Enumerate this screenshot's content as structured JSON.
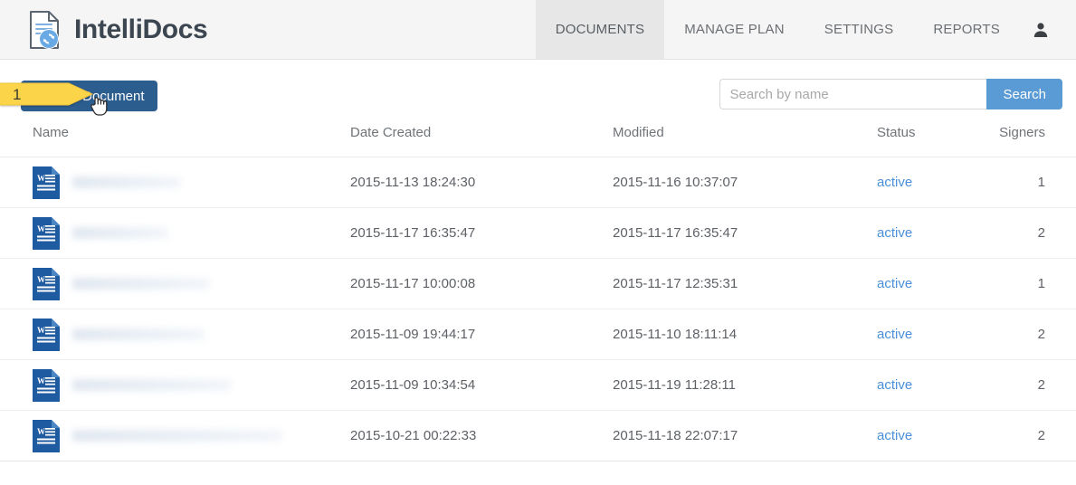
{
  "brand": {
    "name": "IntelliDocs",
    "logo_icon": "document-sync-icon"
  },
  "nav": {
    "items": [
      {
        "label": "DOCUMENTS",
        "active": true
      },
      {
        "label": "MANAGE PLAN",
        "active": false
      },
      {
        "label": "SETTINGS",
        "active": false
      },
      {
        "label": "REPORTS",
        "active": false
      }
    ],
    "user_icon": "user-avatar-icon"
  },
  "toolbar": {
    "new_document_label": "New Document",
    "new_document_icon": "new-document-icon",
    "new_document_color": "#2c5d8f"
  },
  "search": {
    "placeholder": "Search by name",
    "value": "",
    "button_label": "Search",
    "button_color": "#5b9bd5"
  },
  "table": {
    "columns": [
      "Name",
      "Date Created",
      "Modified",
      "Status",
      "Signers"
    ],
    "rows": [
      {
        "icon": "word-document-icon",
        "name": "",
        "name_redacted_width": 120,
        "date_created": "2015-11-13 18:24:30",
        "modified": "2015-11-16 10:37:07",
        "status": "active",
        "signers": "1"
      },
      {
        "icon": "word-document-icon",
        "name": "",
        "name_redacted_width": 106,
        "date_created": "2015-11-17 16:35:47",
        "modified": "2015-11-17 16:35:47",
        "status": "active",
        "signers": "2"
      },
      {
        "icon": "word-document-icon",
        "name": "",
        "name_redacted_width": 152,
        "date_created": "2015-11-17 10:00:08",
        "modified": "2015-11-17 12:35:31",
        "status": "active",
        "signers": "1"
      },
      {
        "icon": "word-document-icon",
        "name": "",
        "name_redacted_width": 146,
        "date_created": "2015-11-09 19:44:17",
        "modified": "2015-11-10 18:11:14",
        "status": "active",
        "signers": "2"
      },
      {
        "icon": "word-document-icon",
        "name": "",
        "name_redacted_width": 176,
        "date_created": "2015-11-09 10:34:54",
        "modified": "2015-11-19 11:28:11",
        "status": "active",
        "signers": "2"
      },
      {
        "icon": "word-document-icon",
        "name": "",
        "name_redacted_width": 232,
        "date_created": "2015-10-21 00:22:33",
        "modified": "2015-11-18 22:07:17",
        "status": "active",
        "signers": "2"
      }
    ],
    "status_link_color": "#4a90d9"
  },
  "annotation": {
    "number": "1",
    "fill_color": "#fbd44a",
    "target": "new-document-button"
  }
}
